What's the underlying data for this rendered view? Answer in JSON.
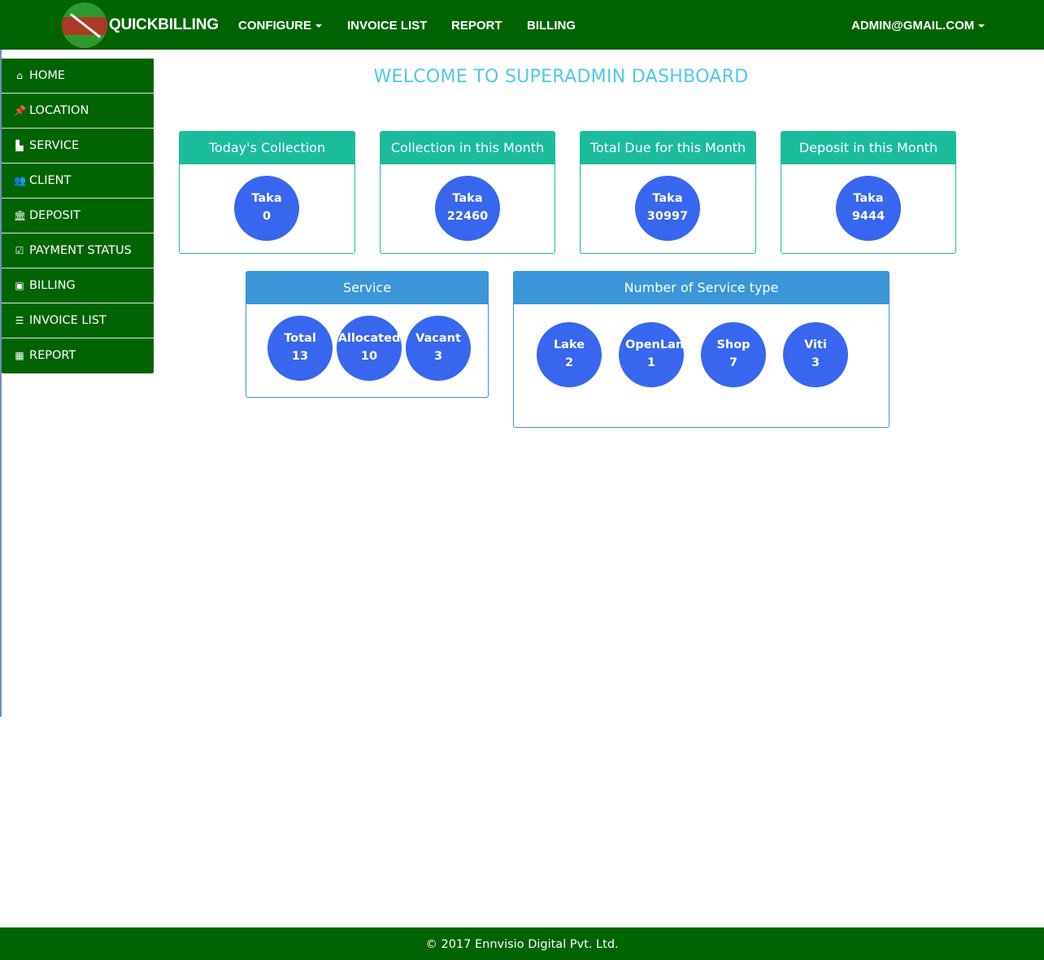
{
  "navbar": {
    "brand": "QUICKBILLING",
    "items": [
      {
        "label": "CONFIGURE",
        "dropdown": true
      },
      {
        "label": "INVOICE LIST"
      },
      {
        "label": "REPORT"
      },
      {
        "label": "BILLING"
      }
    ],
    "user": "ADMIN@GMAIL.COM"
  },
  "sidebar": {
    "items": [
      {
        "label": "HOME",
        "icon": "home-icon",
        "glyph": "⌂"
      },
      {
        "label": "LOCATION",
        "icon": "pushpin-icon",
        "glyph": "📌"
      },
      {
        "label": "SERVICE",
        "icon": "industry-icon",
        "glyph": "▙"
      },
      {
        "label": "CLIENT",
        "icon": "users-icon",
        "glyph": "👥"
      },
      {
        "label": "DEPOSIT",
        "icon": "bank-icon",
        "glyph": "🏛"
      },
      {
        "label": "PAYMENT STATUS",
        "icon": "check-square-icon",
        "glyph": "☑"
      },
      {
        "label": "BILLING",
        "icon": "money-icon",
        "glyph": "▣"
      },
      {
        "label": "INVOICE LIST",
        "icon": "list-alt-icon",
        "glyph": "☰"
      },
      {
        "label": "REPORT",
        "icon": "table-icon",
        "glyph": "▦"
      }
    ]
  },
  "main": {
    "title": "WELCOME TO SUPERADMIN DASHBOARD",
    "stat_panels": [
      {
        "title": "Today's Collection",
        "label": "Taka",
        "value": "0"
      },
      {
        "title": "Collection in this Month",
        "label": "Taka",
        "value": "22460"
      },
      {
        "title": "Total Due for this Month",
        "label": "Taka",
        "value": "30997"
      },
      {
        "title": "Deposit in this Month",
        "label": "Taka",
        "value": "9444"
      }
    ],
    "service_panel": {
      "title": "Service",
      "items": [
        {
          "label": "Total",
          "value": "13"
        },
        {
          "label": "Allocated",
          "value": "10"
        },
        {
          "label": "Vacant",
          "value": "3"
        }
      ]
    },
    "service_type_panel": {
      "title": "Number of Service type",
      "items": [
        {
          "label": "Lake",
          "value": "2"
        },
        {
          "label": "OpenLand",
          "value": "1"
        },
        {
          "label": "Shop",
          "value": "7"
        },
        {
          "label": "Viti",
          "value": "3"
        }
      ]
    }
  },
  "footer": {
    "text": "© 2017 Ennvisio Digital Pvt. Ltd."
  },
  "colors": {
    "navbar": "#006400",
    "teal": "#1abc9c",
    "blue_header": "#3a96d8",
    "circle": "#3766ef",
    "title": "#4fc8e8"
  }
}
